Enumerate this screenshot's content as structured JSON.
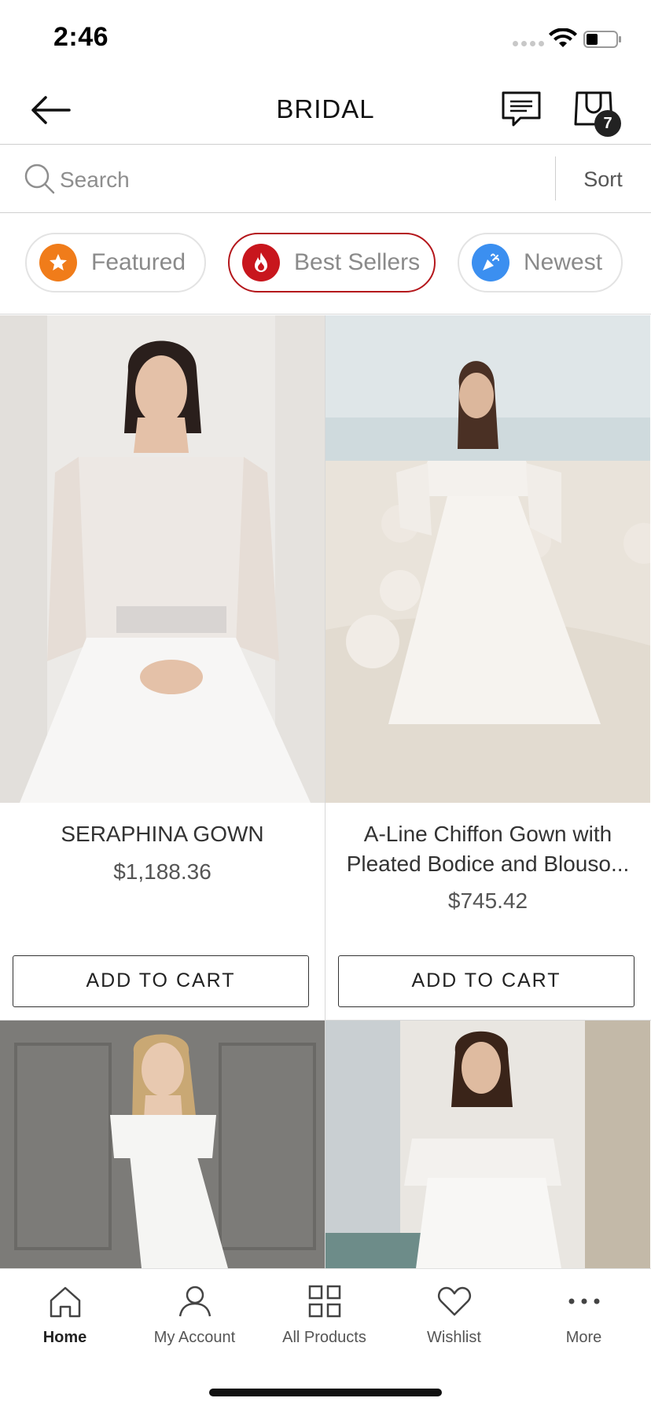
{
  "status_bar": {
    "time": "2:46"
  },
  "header": {
    "title": "BRIDAL",
    "cart_count": "7"
  },
  "search": {
    "placeholder": "Search",
    "value": "",
    "sort_label": "Sort"
  },
  "chips": [
    {
      "label": "Featured",
      "icon": "star-icon",
      "color": "#f07c1a",
      "active": false
    },
    {
      "label": "Best Sellers",
      "icon": "fire-icon",
      "color": "#c8161d",
      "active": true
    },
    {
      "label": "Newest",
      "icon": "party-popper-icon",
      "color": "#3b8ff0",
      "active": false
    }
  ],
  "products": [
    {
      "name": "SERAPHINA GOWN",
      "price": "$1,188.36",
      "cta": "ADD TO CART"
    },
    {
      "name": "A-Line Chiffon Gown with Pleated Bodice and Blouso...",
      "price": "$745.42",
      "cta": "ADD TO CART"
    },
    {
      "name": "",
      "price": "",
      "cta": ""
    },
    {
      "name": "",
      "price": "",
      "cta": ""
    }
  ],
  "tabbar": [
    {
      "label": "Home",
      "icon": "home-icon",
      "active": true
    },
    {
      "label": "My Account",
      "icon": "user-icon",
      "active": false
    },
    {
      "label": "All Products",
      "icon": "grid-icon",
      "active": false
    },
    {
      "label": "Wishlist",
      "icon": "heart-icon",
      "active": false
    },
    {
      "label": "More",
      "icon": "more-dots-icon",
      "active": false
    }
  ],
  "colors": {
    "accent": "#b4161b",
    "text": "#222222",
    "muted": "#8a8a8a",
    "divider": "#d8d8d8"
  }
}
